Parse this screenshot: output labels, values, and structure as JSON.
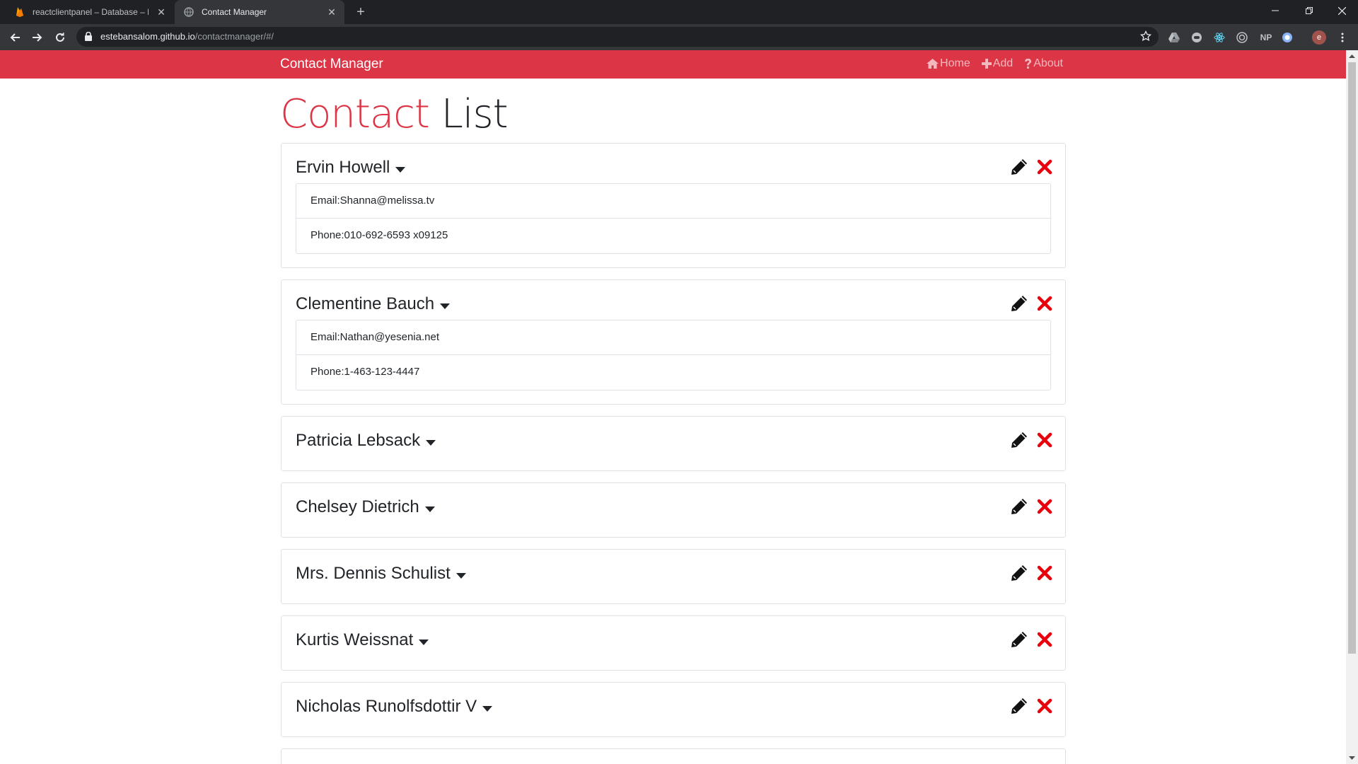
{
  "browser": {
    "tabs": [
      {
        "title": "reactclientpanel – Database – Fir",
        "active": false
      },
      {
        "title": "Contact Manager",
        "active": true
      }
    ],
    "url_host": "estebansalom.github.io",
    "url_path": "/contactmanager/#/",
    "profile_initial": "e",
    "ext_np": "NP"
  },
  "navbar": {
    "brand": "Contact Manager",
    "links": [
      "Home",
      "Add",
      "About"
    ],
    "color": "#dc3545"
  },
  "page": {
    "heading_part1": "Contact",
    "heading_part2": "List"
  },
  "contacts": [
    {
      "name": "Ervin Howell",
      "expanded": true,
      "email": "Email:Shanna@melissa.tv",
      "phone": "Phone:010-692-6593 x09125"
    },
    {
      "name": "Clementine Bauch",
      "expanded": true,
      "email": "Email:Nathan@yesenia.net",
      "phone": "Phone:1-463-123-4447"
    },
    {
      "name": "Patricia Lebsack",
      "expanded": false
    },
    {
      "name": "Chelsey Dietrich",
      "expanded": false
    },
    {
      "name": "Mrs. Dennis Schulist",
      "expanded": false
    },
    {
      "name": "Kurtis Weissnat",
      "expanded": false
    },
    {
      "name": "Nicholas Runolfsdottir V",
      "expanded": false
    }
  ],
  "icons": {
    "edit": "pencil-icon",
    "delete": "times-icon",
    "toggle": "caret-down-icon"
  }
}
